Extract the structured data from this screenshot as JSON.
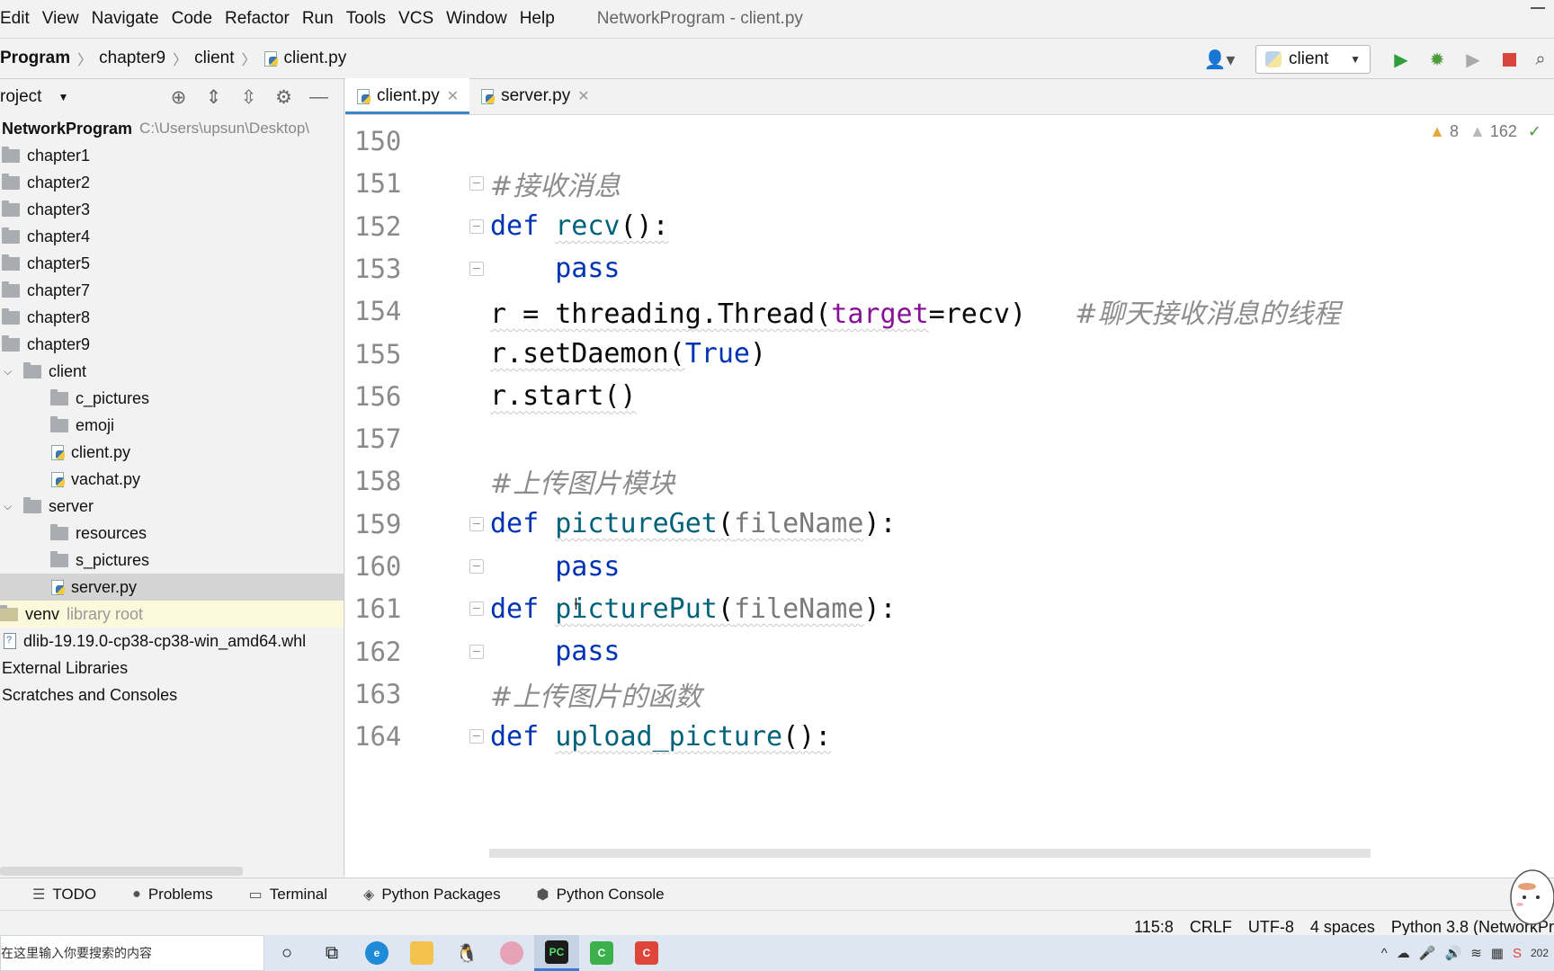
{
  "window": {
    "title": "NetworkProgram - client.py",
    "menu": [
      "Edit",
      "View",
      "Navigate",
      "Code",
      "Refactor",
      "Run",
      "Tools",
      "VCS",
      "Window",
      "Help"
    ]
  },
  "breadcrumb": {
    "project": "Program",
    "folder": "chapter9",
    "subfolder": "client",
    "file": "client.py"
  },
  "toolbar": {
    "run_config": "client",
    "icons": [
      "user-icon",
      "run-icon",
      "debug-icon",
      "coverage-icon",
      "stop-icon",
      "search-icon"
    ]
  },
  "project_panel": {
    "title": "roject",
    "root": {
      "name": "NetworkProgram",
      "path": "C:\\Users\\upsun\\Desktop\\"
    },
    "items": [
      {
        "label": "chapter1",
        "type": "folder",
        "depth": 0
      },
      {
        "label": "chapter2",
        "type": "folder",
        "depth": 0
      },
      {
        "label": "chapter3",
        "type": "folder",
        "depth": 0
      },
      {
        "label": "chapter4",
        "type": "folder",
        "depth": 0
      },
      {
        "label": "chapter5",
        "type": "folder",
        "depth": 0
      },
      {
        "label": "chapter7",
        "type": "folder",
        "depth": 0
      },
      {
        "label": "chapter8",
        "type": "folder",
        "depth": 0
      },
      {
        "label": "chapter9",
        "type": "folder",
        "depth": 0
      },
      {
        "label": "client",
        "type": "folder-open",
        "depth": 1
      },
      {
        "label": "c_pictures",
        "type": "folder",
        "depth": 2
      },
      {
        "label": "emoji",
        "type": "folder",
        "depth": 2
      },
      {
        "label": "client.py",
        "type": "py",
        "depth": 2
      },
      {
        "label": "vachat.py",
        "type": "py",
        "depth": 2
      },
      {
        "label": "server",
        "type": "folder-open",
        "depth": 1
      },
      {
        "label": "resources",
        "type": "folder",
        "depth": 2
      },
      {
        "label": "s_pictures",
        "type": "folder",
        "depth": 2
      },
      {
        "label": "server.py",
        "type": "py",
        "depth": 2,
        "selected": true
      }
    ],
    "venv": {
      "label": "venv",
      "hint": "library root"
    },
    "whl": "dlib-19.19.0-cp38-cp38-win_amd64.whl",
    "external": "External Libraries",
    "scratches": "Scratches and Consoles"
  },
  "tabs": [
    {
      "label": "client.py",
      "active": true
    },
    {
      "label": "server.py",
      "active": false
    }
  ],
  "editor": {
    "inspections": {
      "warnings": "8",
      "weak_warnings": "162"
    },
    "lines": [
      {
        "n": "150",
        "tokens": []
      },
      {
        "n": "151",
        "fold": true,
        "tokens": [
          {
            "t": "#接收消息",
            "c": "comment"
          }
        ]
      },
      {
        "n": "152",
        "fold": true,
        "tokens": [
          {
            "t": "def ",
            "c": "kw"
          },
          {
            "t": "recv",
            "c": "fn"
          },
          {
            "t": "():",
            "c": ""
          }
        ]
      },
      {
        "n": "153",
        "fold": true,
        "tokens": [
          {
            "t": "    ",
            "c": ""
          },
          {
            "t": "pass",
            "c": "kw"
          }
        ]
      },
      {
        "n": "154",
        "tokens": [
          {
            "t": "r = threading.Thread(",
            "c": ""
          },
          {
            "t": "target",
            "c": "named"
          },
          {
            "t": "=recv)   ",
            "c": ""
          },
          {
            "t": "#聊天接收消息的线程",
            "c": "comment"
          }
        ]
      },
      {
        "n": "155",
        "tokens": [
          {
            "t": "r.setDaemon(",
            "c": ""
          },
          {
            "t": "True",
            "c": "kw"
          },
          {
            "t": ")",
            "c": ""
          }
        ]
      },
      {
        "n": "156",
        "tokens": [
          {
            "t": "r.start()",
            "c": ""
          }
        ]
      },
      {
        "n": "157",
        "tokens": []
      },
      {
        "n": "158",
        "tokens": [
          {
            "t": "#上传图片模块",
            "c": "comment"
          }
        ]
      },
      {
        "n": "159",
        "fold": true,
        "tokens": [
          {
            "t": "def ",
            "c": "kw"
          },
          {
            "t": "pictureGet",
            "c": "fn"
          },
          {
            "t": "(",
            "c": ""
          },
          {
            "t": "fileName",
            "c": "param"
          },
          {
            "t": "):",
            "c": ""
          }
        ]
      },
      {
        "n": "160",
        "fold": true,
        "tokens": [
          {
            "t": "    ",
            "c": ""
          },
          {
            "t": "pass",
            "c": "kw"
          }
        ]
      },
      {
        "n": "161",
        "fold": true,
        "tokens": [
          {
            "t": "def ",
            "c": "kw"
          },
          {
            "t": "picturePut",
            "c": "fn"
          },
          {
            "t": "(",
            "c": ""
          },
          {
            "t": "fileName",
            "c": "param"
          },
          {
            "t": "):",
            "c": ""
          }
        ]
      },
      {
        "n": "162",
        "fold": true,
        "tokens": [
          {
            "t": "    ",
            "c": ""
          },
          {
            "t": "pass",
            "c": "kw"
          }
        ]
      },
      {
        "n": "163",
        "tokens": [
          {
            "t": "#上传图片的函数",
            "c": "comment"
          }
        ]
      },
      {
        "n": "164",
        "fold": true,
        "tokens": [
          {
            "t": "def ",
            "c": "kw"
          },
          {
            "t": "upload_picture",
            "c": "fn"
          },
          {
            "t": "():",
            "c": ""
          }
        ]
      }
    ]
  },
  "tool_windows": [
    {
      "label": "TODO",
      "icon": "list-icon"
    },
    {
      "label": "Problems",
      "icon": "problems-icon"
    },
    {
      "label": "Terminal",
      "icon": "terminal-icon"
    },
    {
      "label": "Python Packages",
      "icon": "packages-icon"
    },
    {
      "label": "Python Console",
      "icon": "python-console-icon"
    }
  ],
  "status": {
    "position": "115:8",
    "line_sep": "CRLF",
    "encoding": "UTF-8",
    "indent": "4 spaces",
    "interpreter": "Python 3.8 (NetworkPr"
  },
  "taskbar": {
    "search_placeholder": "在这里输入你要搜索的内容",
    "clock": "202"
  }
}
